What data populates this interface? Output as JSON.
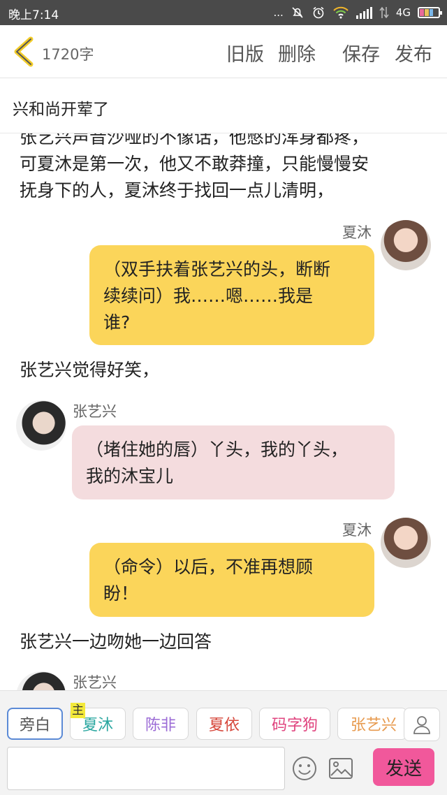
{
  "status_bar": {
    "time": "晚上7:14",
    "dots": "...",
    "network": "4G"
  },
  "header": {
    "word_count": "1720字",
    "old_version": "旧版",
    "delete": "删除",
    "save": "保存",
    "publish": "发布"
  },
  "title": "兴和尚开荤了",
  "content": {
    "narration_1": "张艺兴声音沙哑的不像话，他憋的浑身都疼，\n可夏沐是第一次，他又不敢莽撞，只能慢慢安\n抚身下的人，夏沐终于找回一点儿清明，",
    "msg_1_name": "夏沐",
    "msg_1_text": "（双手扶着张艺兴的头，断断\n续续问）我……嗯……我是\n谁?",
    "narration_2": "张艺兴觉得好笑，",
    "msg_2_name": "张艺兴",
    "msg_2_text": "（堵住她的唇）丫头，我的丫头，\n我的沐宝儿",
    "msg_3_name": "夏沐",
    "msg_3_text": "（命令）以后，不准再想顾\n盼！",
    "narration_3": "张艺兴一边吻她一边回答",
    "msg_4_name": "张艺兴"
  },
  "characters": {
    "narrator": "旁白",
    "main_badge": "主",
    "c1": "夏沐",
    "c2": "陈非",
    "c3": "夏依",
    "c4": "码字狗",
    "c5": "张艺兴"
  },
  "colors": {
    "c1": "#2aa7a0",
    "c2": "#9b6bd6",
    "c3": "#d6463a",
    "c4": "#e0457f",
    "c5": "#e79a4e",
    "send_bg": "#f1589b",
    "bubble_yellow": "#fbd55a",
    "bubble_pink": "#f4dcde"
  },
  "composer": {
    "send": "发送",
    "input_value": ""
  }
}
